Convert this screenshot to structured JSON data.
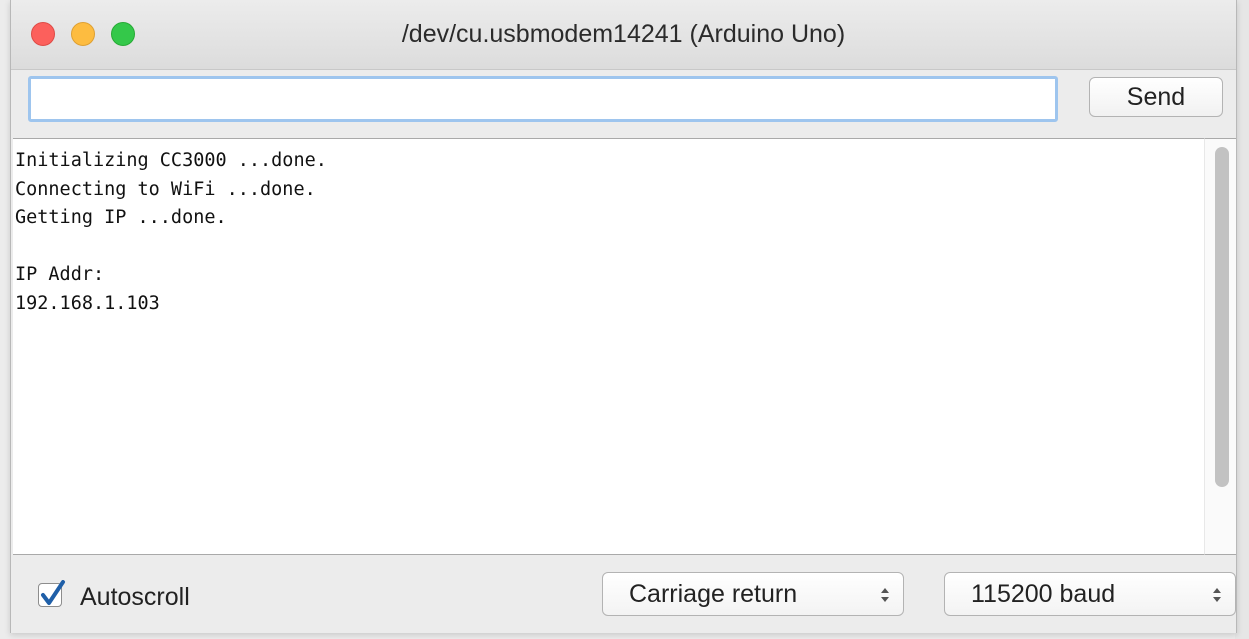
{
  "window": {
    "title": "/dev/cu.usbmodem14241 (Arduino Uno)"
  },
  "toolbar": {
    "input_value": "",
    "send_label": "Send"
  },
  "output": {
    "lines": [
      "Initializing CC3000 ...done.",
      "Connecting to WiFi ...done.",
      "Getting IP ...done.",
      "",
      "IP Addr:",
      "192.168.1.103"
    ]
  },
  "statusbar": {
    "autoscroll_label": "Autoscroll",
    "autoscroll_checked": true,
    "line_ending": "Carriage return",
    "baud_rate": "115200 baud"
  },
  "colors": {
    "close": "#fc605c",
    "minimize": "#fdbc40",
    "maximize": "#34c84a",
    "input_focus": "#9ec5ee",
    "checkbox_check": "#1f5fa8"
  },
  "icons": [
    "close-window-icon",
    "minimize-window-icon",
    "maximize-window-icon",
    "checkmark-icon",
    "up-down-arrows-icon"
  ]
}
